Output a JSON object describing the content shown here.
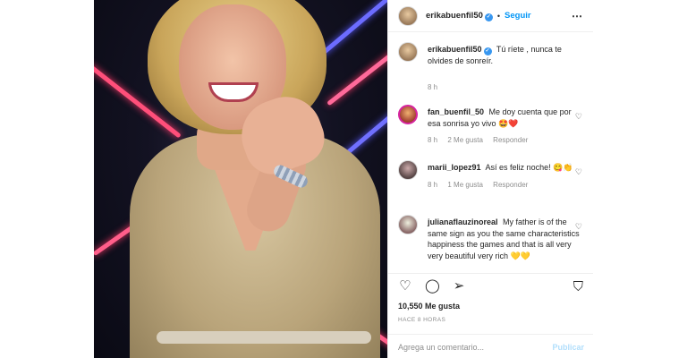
{
  "post": {
    "username": "erikabuenfil50",
    "follow_label": "Seguir",
    "more_icon": "ellipsis-icon",
    "caption": "Tú ríete , nunca te olvides de sonreír.",
    "caption_time": "8 h"
  },
  "comments": [
    {
      "user": "fan_buenfil_50",
      "text": "Me doy cuenta que por esa sonrisa yo vivo 🤩❤️",
      "time": "8 h",
      "likes": "2 Me gusta",
      "reply": "Responder"
    },
    {
      "user": "marii_lopez91",
      "text": "Así es feliz noche! 😋👏",
      "time": "8 h",
      "likes": "1 Me gusta",
      "reply": "Responder"
    },
    {
      "user": "julianaflauzinoreal",
      "text": "My father is of the same sign as you the same characteristics happiness the games and that is all very very beautiful very rich 💛💛"
    }
  ],
  "actions": {
    "likes": "10,550 Me gusta",
    "timestamp": "HACE 8 HORAS",
    "comment_placeholder": "Agrega un comentario...",
    "publish_label": "Publicar"
  },
  "colors": {
    "link_blue": "#0095f6",
    "publish_disabled": "#b2dffc",
    "meta_gray": "#8e8e8e"
  }
}
